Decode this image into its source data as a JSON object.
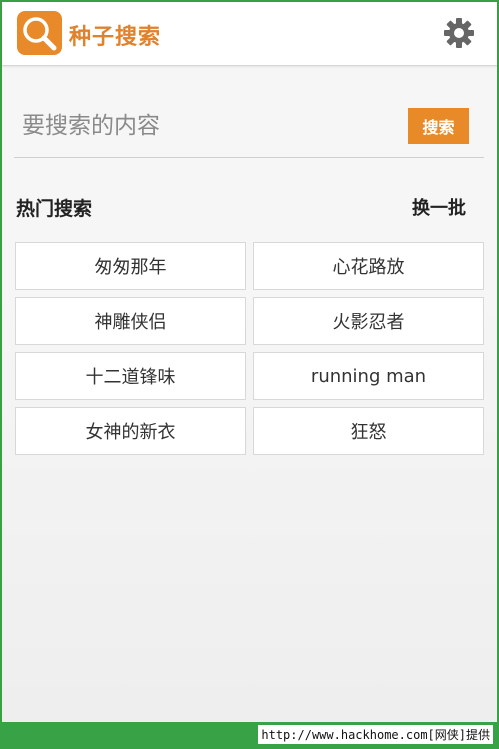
{
  "app": {
    "title": "种子搜索",
    "logo_icon": "magnifier-icon",
    "settings_icon": "gear-icon",
    "accent_color": "#e98a28"
  },
  "search": {
    "placeholder": "要搜索的内容",
    "value": "",
    "button_label": "搜索"
  },
  "hot": {
    "title": "热门搜索",
    "refresh_label": "换一批",
    "items": [
      "匆匆那年",
      "心花路放",
      "神雕侠侣",
      "火影忍者",
      "十二道锋味",
      "running man",
      "女神的新衣",
      "狂怒"
    ]
  },
  "footer": {
    "watermark": "http://www.hackhome.com[网侠]提供"
  }
}
